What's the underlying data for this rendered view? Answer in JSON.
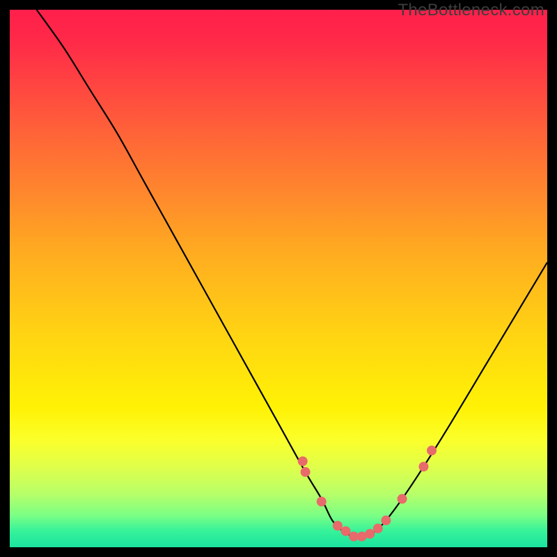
{
  "watermark": "TheBottleneck.com",
  "chart_data": {
    "type": "line",
    "title": "",
    "xlabel": "",
    "ylabel": "",
    "xlim": [
      0,
      100
    ],
    "ylim": [
      0,
      100
    ],
    "series": [
      {
        "name": "curve",
        "x": [
          5,
          10,
          15,
          20,
          25,
          30,
          35,
          40,
          45,
          50,
          55,
          58,
          60,
          62,
          64,
          66,
          68,
          70,
          73,
          77,
          82,
          88,
          94,
          100
        ],
        "y": [
          100,
          93,
          85,
          77,
          68,
          59,
          50,
          41,
          32,
          23,
          14,
          9,
          5,
          3,
          2,
          2,
          3,
          5,
          9,
          15,
          23,
          33,
          43,
          53
        ]
      }
    ],
    "markers": {
      "name": "dots",
      "color": "#e86a6a",
      "x": [
        54.5,
        55,
        58,
        61,
        62.5,
        64,
        65.5,
        67,
        68.5,
        70,
        73,
        77,
        78.5
      ],
      "y": [
        16,
        14,
        8.5,
        4,
        3,
        2,
        2,
        2.5,
        3.5,
        5,
        9,
        15,
        18
      ]
    },
    "gradient_stops": [
      {
        "pos": 0,
        "color": "#ff1f4b"
      },
      {
        "pos": 25,
        "color": "#ff6a36"
      },
      {
        "pos": 50,
        "color": "#ffbc18"
      },
      {
        "pos": 75,
        "color": "#fff808"
      },
      {
        "pos": 100,
        "color": "#1be39f"
      }
    ]
  }
}
